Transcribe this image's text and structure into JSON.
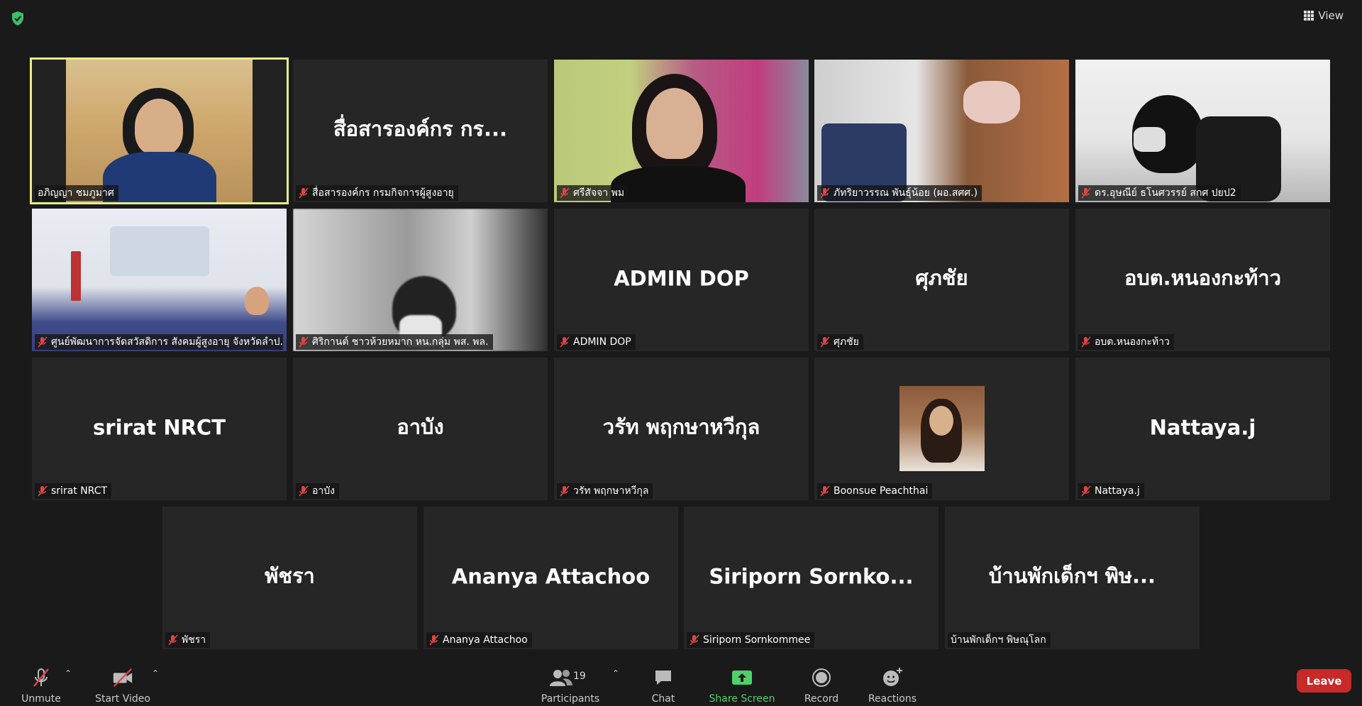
{
  "top": {
    "view_label": "View"
  },
  "tiles": [
    {
      "label": "อภิญญา ชมภูมาศ",
      "big": ""
    },
    {
      "label": "สื่อสารองค์กร กรมกิจการผู้สูงอายุ",
      "big": "สื่อสารองค์กร กร..."
    },
    {
      "label": "ศรีสัจจา พม",
      "big": ""
    },
    {
      "label": "ภัทริยาวรรณ พันธุ์น้อย (ผอ.สศศ.)",
      "big": ""
    },
    {
      "label": "ดร.อุษณีย์ ธโนศวรรย์ สกศ ปยป2",
      "big": ""
    },
    {
      "label": "ศูนย์พัฒนาการจัดสวัสดิการ สังคมผู้สูงอายุ จังหวัดลำป...",
      "big": ""
    },
    {
      "label": "ศิริกานต์ ชาวห้วยหมาก หน.กลุ่ม พส. พล.",
      "big": ""
    },
    {
      "label": "ADMIN DOP",
      "big": "ADMIN DOP"
    },
    {
      "label": "ศุภชัย",
      "big": "ศุภชัย"
    },
    {
      "label": "อบต.หนองกะท้าว",
      "big": "อบต.หนองกะท้าว"
    },
    {
      "label": "srirat NRCT",
      "big": "srirat NRCT"
    },
    {
      "label": "อาบัง",
      "big": "อาบัง"
    },
    {
      "label": "วรัท  พฤกษาหวีกุล",
      "big": "วรัท  พฤกษาหวีกุล"
    },
    {
      "label": "Boonsue Peachthai",
      "big": ""
    },
    {
      "label": "Nattaya.j",
      "big": "Nattaya.j"
    },
    {
      "label": "พัชรา",
      "big": "พัชรา"
    },
    {
      "label": "Ananya Attachoo",
      "big": "Ananya Attachoo"
    },
    {
      "label": "Siriporn Sornkommee",
      "big": "Siriporn  Sornko..."
    },
    {
      "label": "บ้านพักเด็กฯ พิษณุโลก",
      "big": "บ้านพักเด็กฯ พิษ..."
    }
  ],
  "toolbar": {
    "unmute": "Unmute",
    "start_video": "Start Video",
    "participants": "Participants",
    "participants_count": "19",
    "chat": "Chat",
    "share_screen": "Share Screen",
    "record": "Record",
    "reactions": "Reactions",
    "leave": "Leave"
  },
  "colors": {
    "active_speaker": "#e4ef8a",
    "share_green": "#4fd06b",
    "leave_red": "#c82929",
    "mic_off_red": "#e04545"
  }
}
